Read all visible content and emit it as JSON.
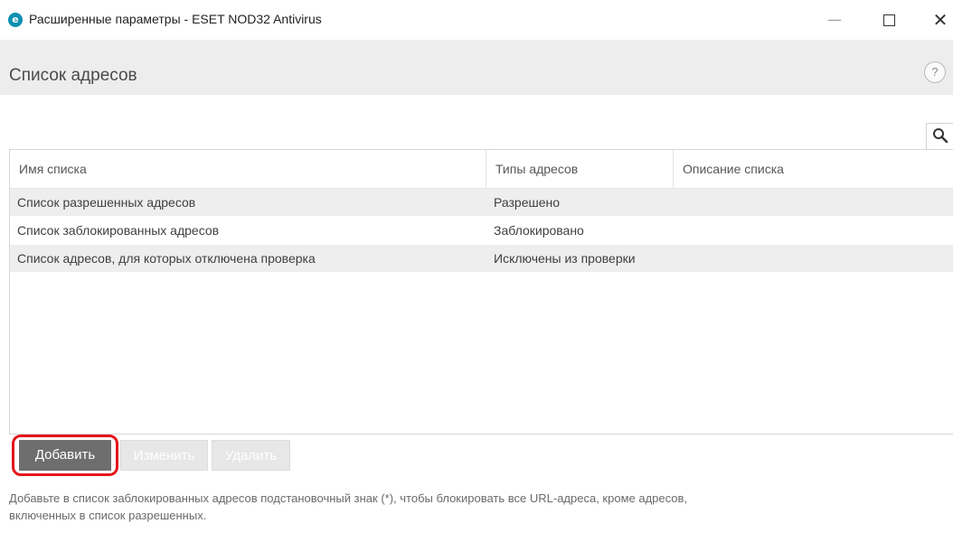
{
  "window": {
    "title": "Расширенные параметры - ESET NOD32 Antivirus",
    "app_icon_letter": "e",
    "controls": {
      "minimize": "—",
      "close": "✕"
    }
  },
  "header": {
    "title": "Список адресов",
    "help_label": "?"
  },
  "table": {
    "columns": [
      "Имя списка",
      "Типы адресов",
      "Описание списка"
    ],
    "rows": [
      {
        "name": "Список разрешенных адресов",
        "type": "Разрешено",
        "description": ""
      },
      {
        "name": "Список заблокированных адресов",
        "type": "Заблокировано",
        "description": ""
      },
      {
        "name": "Список адресов, для которых отключена проверка",
        "type": "Исключены из проверки",
        "description": ""
      }
    ]
  },
  "buttons": {
    "add": "Добавить",
    "edit": "Изменить",
    "delete": "Удалить"
  },
  "hint": {
    "line1": "Добавьте в список заблокированных адресов подстановочный знак (*), чтобы блокировать все URL-адреса, кроме адресов,",
    "line2": "включенных в список разрешенных."
  },
  "colors": {
    "brand": "#0f8fb0",
    "highlight": "#e5161b",
    "primary_button": "#6e6e6e",
    "disabled_button": "#e7e7e7"
  }
}
